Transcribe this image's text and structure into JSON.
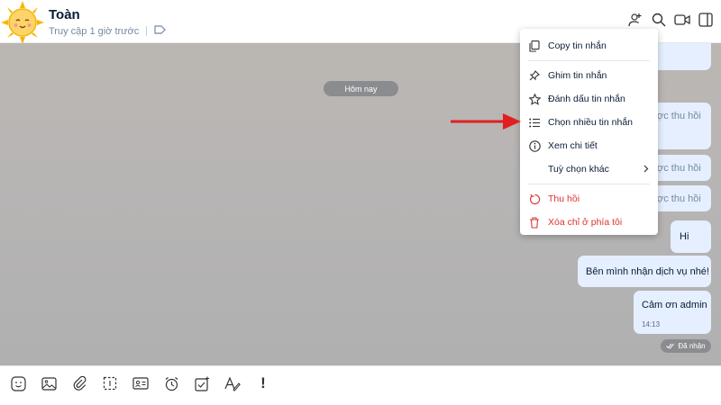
{
  "header": {
    "contact_name": "Toàn",
    "last_seen": "Truy cập 1 giờ trước",
    "icons": [
      "tag-icon",
      "add-member-icon",
      "search-icon",
      "video-call-icon",
      "sidebar-toggle-icon"
    ]
  },
  "chat": {
    "date_divider": "Hôm nay",
    "messages": [
      {
        "text": "ợc thu hồi"
      },
      {
        "text": "ợc thu hồi"
      },
      {
        "text": "ợc thu hồi"
      },
      {
        "text": "Hi"
      },
      {
        "text": "Bên mình nhận dịch vụ nhé!"
      },
      {
        "text": "Cảm ơn admin",
        "time": "14:13"
      }
    ],
    "status": "Đã nhận"
  },
  "menu": {
    "items": [
      {
        "label": "Copy tin nhắn",
        "icon": "copy-icon"
      },
      {
        "label": "Ghim tin nhắn",
        "icon": "pin-icon"
      },
      {
        "label": "Đánh dấu tin nhắn",
        "icon": "star-icon"
      },
      {
        "label": "Chọn nhiều tin nhắn",
        "icon": "list-icon"
      },
      {
        "label": "Xem chi tiết",
        "icon": "info-icon"
      },
      {
        "label": "Tuỳ chọn khác",
        "icon": "chevron-right-icon"
      },
      {
        "label": "Thu hồi",
        "icon": "undo-icon"
      },
      {
        "label": "Xóa chỉ ở phía tôi",
        "icon": "trash-icon"
      }
    ],
    "danger_color": "#db342e"
  },
  "toolbar": {
    "icons": [
      "sticker-icon",
      "image-icon",
      "attachment-icon",
      "screenshot-icon",
      "contact-card-icon",
      "reminder-icon",
      "task-icon",
      "format-text-icon",
      "urgent-icon"
    ],
    "urgent_label": "!"
  },
  "colors": {
    "bubble": "#e5efff",
    "accent": "#0068ff",
    "arrow": "#e02020"
  }
}
